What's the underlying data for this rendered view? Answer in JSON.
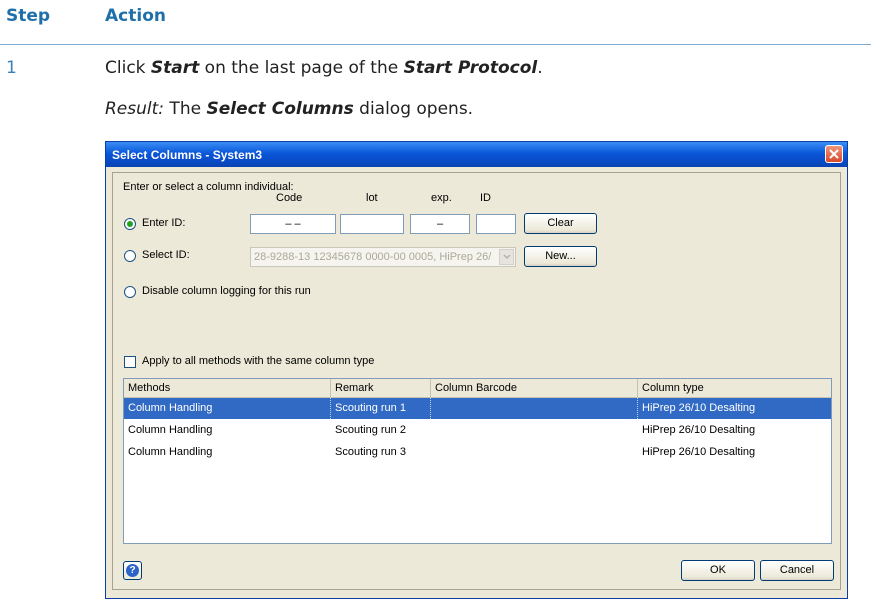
{
  "doc": {
    "header_step": "Step",
    "header_action": "Action",
    "step_number": "1",
    "instruction": {
      "prefix": "Click ",
      "start": "Start",
      "middle": " on the last page of the ",
      "start_protocol": "Start Protocol",
      "suffix": "."
    },
    "result": {
      "label": "Result:",
      "prefix": " The ",
      "dialog_name": "Select Columns",
      "suffix": " dialog opens."
    }
  },
  "dialog": {
    "title": "Select Columns - System3",
    "prompt": "Enter or select a column individual:",
    "col_code": "Code",
    "col_lot": "lot",
    "col_exp": "exp.",
    "col_id": "ID",
    "enter_id_label": "Enter ID:",
    "code_value": "–    –",
    "exp_value": "–",
    "clear_label": "Clear",
    "select_id_label": "Select ID:",
    "select_id_value": "28-9288-13 12345678 0000-00 0005, HiPrep 26/",
    "new_label": "New...",
    "disable_label": "Disable column logging for this run",
    "apply_label": "Apply to all methods with the same column type",
    "table_headers": [
      "Methods",
      "Remark",
      "Column Barcode",
      "Column type"
    ],
    "rows": [
      [
        "Column Handling",
        "Scouting run 1",
        "",
        "HiPrep 26/10 Desalting"
      ],
      [
        "Column Handling",
        "Scouting run 2",
        "",
        "HiPrep 26/10 Desalting"
      ],
      [
        "Column Handling",
        "Scouting run 3",
        "",
        "HiPrep 26/10 Desalting"
      ]
    ],
    "ok_label": "OK",
    "cancel_label": "Cancel"
  }
}
